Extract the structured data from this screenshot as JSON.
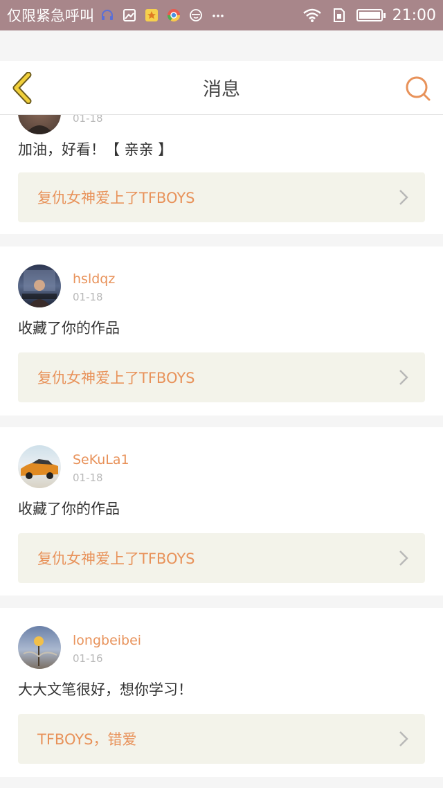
{
  "status_bar": {
    "notification_text": "仅限紧急呼叫",
    "time": "21:00",
    "icons": [
      "headset-icon",
      "gallery-icon",
      "star-app-icon",
      "chrome-icon",
      "face-icon",
      "more-icon",
      "wifi-icon",
      "sim-icon",
      "battery-icon"
    ]
  },
  "header": {
    "title": "消息",
    "back_icon": "chevron-left-icon",
    "search_icon": "search-icon",
    "accent_color": "#e8925a",
    "back_color": "#e6c22e"
  },
  "messages": [
    {
      "date": "01-18",
      "content": "加油，好看！【 亲亲 】",
      "work_title": "复仇女神爱上了TFBOYS"
    },
    {
      "username": "hsldqz",
      "date": "01-18",
      "content": "收藏了你的作品",
      "work_title": "复仇女神爱上了TFBOYS"
    },
    {
      "username": "SeKuLa1",
      "date": "01-18",
      "content": "收藏了你的作品",
      "work_title": "复仇女神爱上了TFBOYS"
    },
    {
      "username": "longbeibei",
      "date": "01-16",
      "content": "大大文笔很好，想你学习！",
      "work_title": "TFBOYS，错爱"
    }
  ]
}
